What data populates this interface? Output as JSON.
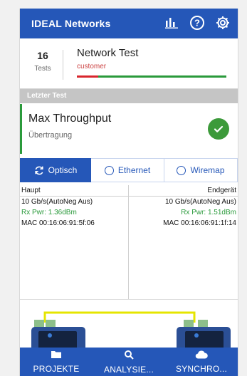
{
  "header": {
    "title": "IDEAL Networks",
    "icons": [
      "chart-icon",
      "help-icon",
      "gear-icon"
    ]
  },
  "project": {
    "test_count": "16",
    "tests_label": "Tests",
    "name": "Network Test",
    "customer": "customer"
  },
  "section_label": "Letzter Test",
  "last_test": {
    "name": "Max Throughput",
    "subtitle": "Übertragung",
    "status": "passed"
  },
  "tabs": [
    {
      "label": "Optisch",
      "active": true
    },
    {
      "label": "Ethernet",
      "active": false
    },
    {
      "label": "Wiremap",
      "active": false
    }
  ],
  "results": {
    "left": {
      "header": "Haupt",
      "speed": "10 Gb/s(AutoNeg Aus)",
      "rx_pwr": "Rx Pwr: 1.36dBm",
      "mac": "MAC 00:16:06:91:5f:06"
    },
    "right": {
      "header": "Endgerät",
      "speed": "10 Gb/s(AutoNeg Aus)",
      "rx_pwr": "Rx Pwr: 1.51dBm",
      "mac": "MAC 00:16:06:91:1f:14"
    }
  },
  "bottom_nav": [
    {
      "label": "PROJEKTE",
      "icon": "folder-icon"
    },
    {
      "label": "ANALYSIE...",
      "icon": "search-icon"
    },
    {
      "label": "SYNCHRO...",
      "icon": "cloud-icon"
    }
  ],
  "colors": {
    "primary": "#2557b8",
    "success": "#2a9a3b",
    "alert": "#d8262d"
  }
}
